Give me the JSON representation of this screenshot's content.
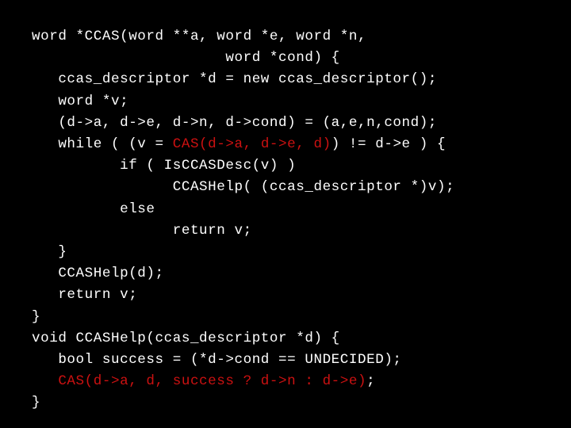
{
  "slide": {
    "background_color": "#000000",
    "default_text_color": "#ffffff",
    "highlight_color": "#cc1111",
    "language": "C++",
    "title_text": ""
  },
  "code": {
    "lines": [
      {
        "index": 1,
        "text": "word *CCAS(word **a, word *e, word *n,",
        "segments": [
          {
            "text": "word *CCAS(word **a, word *e, word *n,",
            "style": "plain"
          }
        ]
      },
      {
        "index": 2,
        "text": "                      word *cond) {",
        "segments": [
          {
            "text": "                      word *cond) {",
            "style": "plain"
          }
        ]
      },
      {
        "index": 3,
        "text": "   ccas_descriptor *d = new ccas_descriptor();",
        "segments": [
          {
            "text": "   ccas_descriptor *d = new ccas_descriptor();",
            "style": "plain"
          }
        ]
      },
      {
        "index": 4,
        "text": "   word *v;",
        "segments": [
          {
            "text": "   word *v;",
            "style": "plain"
          }
        ]
      },
      {
        "index": 5,
        "text": "   (d->a, d->e, d->n, d->cond) = (a,e,n,cond);",
        "segments": [
          {
            "text": "   (d->a, d->e, d->n, d->cond) = (a,e,n,cond);",
            "style": "plain"
          }
        ]
      },
      {
        "index": 6,
        "text": "   while ( (v = CAS(d->a, d->e, d)) != d->e ) {",
        "segments": [
          {
            "text": "   while ( (v = ",
            "style": "plain"
          },
          {
            "text": "CAS(d->a, d->e, d)",
            "style": "cas"
          },
          {
            "text": ") != d->e ) {",
            "style": "plain"
          }
        ]
      },
      {
        "index": 7,
        "text": "          if ( IsCCASDesc(v) )",
        "segments": [
          {
            "text": "          if ( IsCCASDesc(v) )",
            "style": "plain"
          }
        ]
      },
      {
        "index": 8,
        "text": "                CCASHelp( (ccas_descriptor *)v);",
        "segments": [
          {
            "text": "                CCASHelp( (ccas_descriptor *)v);",
            "style": "plain"
          }
        ]
      },
      {
        "index": 9,
        "text": "          else",
        "segments": [
          {
            "text": "          else",
            "style": "plain"
          }
        ]
      },
      {
        "index": 10,
        "text": "                return v;",
        "segments": [
          {
            "text": "                return v;",
            "style": "plain"
          }
        ]
      },
      {
        "index": 11,
        "text": "   }",
        "segments": [
          {
            "text": "   }",
            "style": "plain"
          }
        ]
      },
      {
        "index": 12,
        "text": "   CCASHelp(d);",
        "segments": [
          {
            "text": "   CCASHelp(d);",
            "style": "plain"
          }
        ]
      },
      {
        "index": 13,
        "text": "   return v;",
        "segments": [
          {
            "text": "   return v;",
            "style": "plain"
          }
        ]
      },
      {
        "index": 14,
        "text": "}",
        "segments": [
          {
            "text": "}",
            "style": "plain"
          }
        ]
      },
      {
        "index": 15,
        "text": "void CCASHelp(ccas_descriptor *d) {",
        "segments": [
          {
            "text": "void CCASHelp(ccas_descriptor *d) {",
            "style": "plain"
          }
        ]
      },
      {
        "index": 16,
        "text": "   bool success = (*d->cond == UNDECIDED);",
        "segments": [
          {
            "text": "   bool success = (*d->cond == UNDECIDED);",
            "style": "plain"
          }
        ]
      },
      {
        "index": 17,
        "text": "   CAS(d->a, d, success ? d->n : d->e);",
        "segments": [
          {
            "text": "   ",
            "style": "plain"
          },
          {
            "text": "CAS(d->a, d, success ? d->n : d->e)",
            "style": "cas"
          },
          {
            "text": ";",
            "style": "plain"
          }
        ]
      },
      {
        "index": 18,
        "text": "}",
        "segments": [
          {
            "text": "}",
            "style": "plain"
          }
        ]
      }
    ]
  }
}
